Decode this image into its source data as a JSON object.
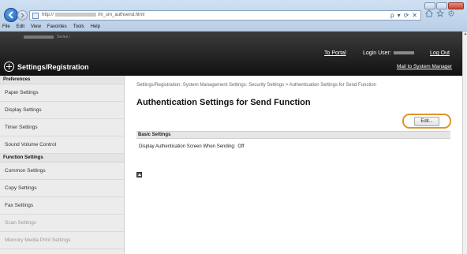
{
  "browser": {
    "url_prefix": "http://",
    "url_suffix": "/m_sm_authsend.html",
    "search_glyph": "ρ",
    "dropdown_glyph": "▾",
    "refresh_glyph": "⟳",
    "stop_glyph": "✕",
    "menu": [
      "File",
      "Edit",
      "View",
      "Favorites",
      "Tools",
      "Help"
    ]
  },
  "header": {
    "model_label": "Series /",
    "title": "Settings/Registration",
    "to_portal": "To Portal",
    "login_user_label": "Login User:",
    "logout": "Log Out",
    "mail_admin": "Mail to System Manager"
  },
  "sidebar": {
    "groups": [
      {
        "label": "Preferences",
        "items": [
          {
            "label": "Paper Settings",
            "dim": false
          },
          {
            "label": "Display Settings",
            "dim": false
          },
          {
            "label": "Timer Settings",
            "dim": false
          },
          {
            "label": "Sound Volume Control",
            "dim": false
          }
        ]
      },
      {
        "label": "Function Settings",
        "items": [
          {
            "label": "Common Settings",
            "dim": false
          },
          {
            "label": "Copy Settings",
            "dim": false
          },
          {
            "label": "Fax Settings",
            "dim": false
          },
          {
            "label": "Scan Settings",
            "dim": false
          },
          {
            "label": "Memory Media Print Settings",
            "dim": true
          }
        ]
      }
    ]
  },
  "main": {
    "breadcrumb": "Settings/Registration: System Management Settings: Security Settings > Authentication Settings for Send Function",
    "title": "Authentication Settings for Send Function",
    "edit_label": "Edit...",
    "section_title": "Basic Settings",
    "setting_label": "Display Authentication Screen When Sending:",
    "setting_value": "Off"
  },
  "colors": {
    "edit_highlight": "#e0942b",
    "header_bg": "#1a1a1a",
    "sidebar_bg": "#ececec"
  },
  "icons": {
    "back": "back-arrow-icon",
    "forward": "forward-arrow-icon",
    "home": "home-icon",
    "favorites": "star-icon",
    "tools": "gear-icon",
    "logo": "settings-logo-icon",
    "page_top": "page-top-icon"
  }
}
